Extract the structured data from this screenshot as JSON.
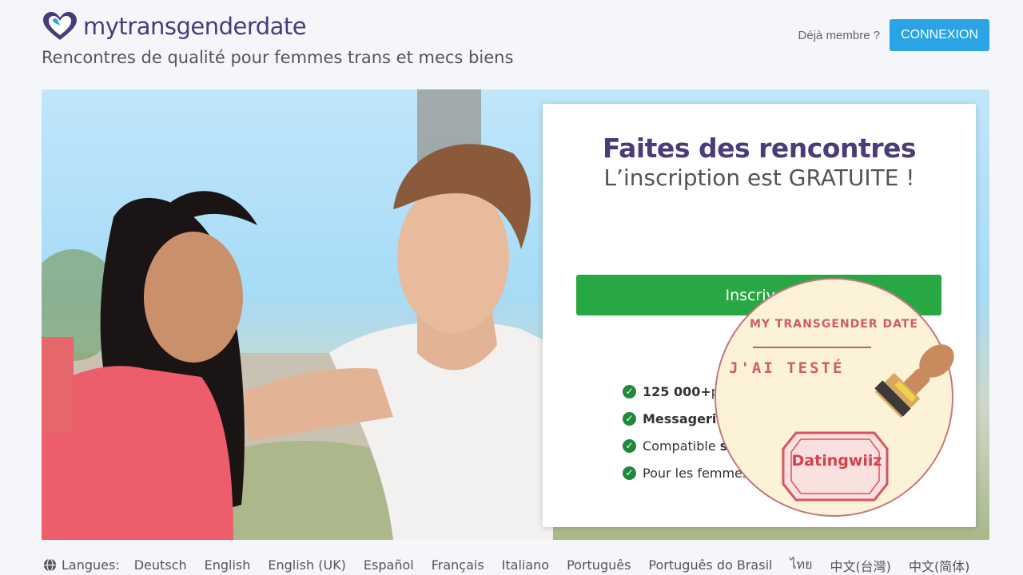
{
  "brand": {
    "name": "mytransgenderdate",
    "tagline": "Rencontres de qualité pour femmes trans et mecs biens",
    "accent": "#4a3b7a"
  },
  "header": {
    "member_question": "Déjà membre ?",
    "login_label": "CONNEXION",
    "login_color": "#2aa4e4"
  },
  "card": {
    "title": "Faites des rencontres",
    "subtitle": "L’inscription est GRATUITE !",
    "signup_label": "Inscrivez",
    "signup_color": "#28a745",
    "features": [
      {
        "bold": "125 000+",
        "rest": " p"
      },
      {
        "bold": "Messagerie",
        "rest": ""
      },
      {
        "bold": "",
        "rest": "Compatible ",
        "tail": "s"
      },
      {
        "bold": "",
        "rest": "Pour les femmes"
      }
    ]
  },
  "stamp": {
    "title": "MY TRANSGENDER DATE",
    "tested": "J'AI TESTÉ",
    "brand": "Datingwiiz"
  },
  "footer": {
    "label": "Langues:",
    "languages": [
      "Deutsch",
      "English",
      "English (UK)",
      "Español",
      "Français",
      "Italiano",
      "Português",
      "Português do Brasil",
      "ไทย",
      "中文(台灣)",
      "中文(简体)"
    ]
  }
}
